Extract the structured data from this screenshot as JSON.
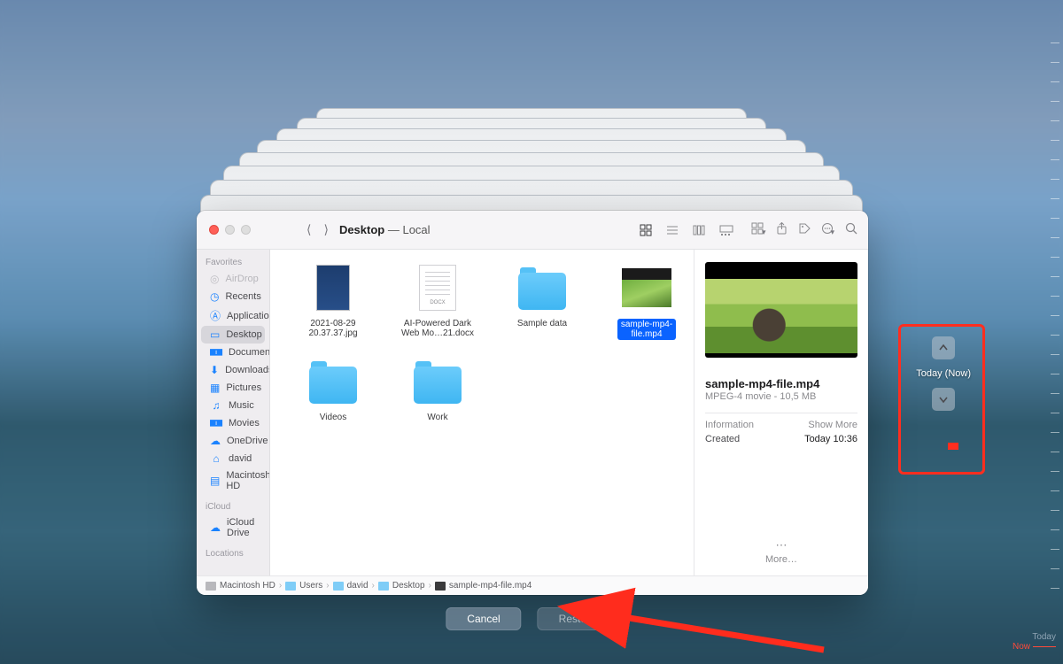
{
  "window_title_bold": "Desktop",
  "window_title_rest": "— Local",
  "sidebar": {
    "sections": [
      {
        "header": "Favorites",
        "items": [
          {
            "icon": "airdrop",
            "label": "AirDrop",
            "disabled": true
          },
          {
            "icon": "clock",
            "label": "Recents"
          },
          {
            "icon": "apps",
            "label": "Applications"
          },
          {
            "icon": "desktop",
            "label": "Desktop",
            "selected": true
          },
          {
            "icon": "doc",
            "label": "Documents"
          },
          {
            "icon": "down",
            "label": "Downloads"
          },
          {
            "icon": "pic",
            "label": "Pictures"
          },
          {
            "icon": "music",
            "label": "Music"
          },
          {
            "icon": "movie",
            "label": "Movies"
          },
          {
            "icon": "cloud",
            "label": "OneDrive"
          },
          {
            "icon": "home",
            "label": "david"
          },
          {
            "icon": "hd",
            "label": "Macintosh HD"
          }
        ]
      },
      {
        "header": "iCloud",
        "items": [
          {
            "icon": "icloud",
            "label": "iCloud Drive"
          }
        ]
      },
      {
        "header": "Locations",
        "items": []
      }
    ]
  },
  "files": [
    {
      "kind": "img",
      "line1": "2021-08-29",
      "line2": "20.37.37.jpg"
    },
    {
      "kind": "docx",
      "line1": "AI-Powered Dark",
      "line2": "Web Mo…21.docx"
    },
    {
      "kind": "folder",
      "line1": "Sample data",
      "line2": ""
    },
    {
      "kind": "video",
      "line1": "sample-mp4-",
      "line2": "file.mp4",
      "selected": true
    },
    {
      "kind": "folder",
      "line1": "Videos",
      "line2": ""
    },
    {
      "kind": "folder",
      "line1": "Work",
      "line2": ""
    }
  ],
  "preview": {
    "name": "sample-mp4-file.mp4",
    "meta": "MPEG-4 movie - 10,5 MB",
    "info_label": "Information",
    "show_more": "Show More",
    "created_label": "Created",
    "created_value": "Today 10:36",
    "more": "More…"
  },
  "pathbar": [
    "Macintosh HD",
    "Users",
    "david",
    "Desktop",
    "sample-mp4-file.mp4"
  ],
  "buttons": {
    "cancel": "Cancel",
    "restore": "Restore"
  },
  "timenav": {
    "label": "Today (Now)"
  },
  "timeline": {
    "today": "Today",
    "now": "Now"
  }
}
